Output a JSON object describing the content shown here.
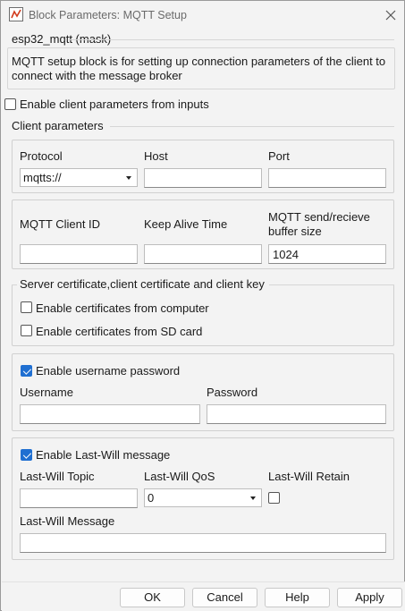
{
  "window": {
    "title": "Block Parameters: MQTT Setup",
    "accent": "#1f6fd1"
  },
  "mask": {
    "heading": "esp32_mqtt (mask)",
    "description_line1": "MQTT setup block is for setting up connection parameters of the client to",
    "description_line2": "connect with the message broker"
  },
  "enable_inputs": {
    "label": "Enable client parameters from inputs",
    "checked": false
  },
  "client_params": {
    "title": "Client parameters",
    "protocol_label": "Protocol",
    "protocol_value": "mqtts://",
    "host_label": "Host",
    "host_value": "",
    "port_label": "Port",
    "port_value": "",
    "client_id_label": "MQTT Client ID",
    "client_id_value": "",
    "keep_alive_label": "Keep Alive Time",
    "keep_alive_value": "",
    "buffer_label_line1": "MQTT send/recieve",
    "buffer_label_line2": "buffer size",
    "buffer_value": "1024"
  },
  "certificates": {
    "title": "Server certificate,client certificate and client key",
    "from_computer_label": "Enable certificates from computer",
    "from_computer_checked": false,
    "from_sd_label": "Enable certificates from SD card",
    "from_sd_checked": false
  },
  "auth": {
    "enable_label": "Enable username password",
    "enable_checked": true,
    "username_label": "Username",
    "username_value": "",
    "password_label": "Password",
    "password_value": ""
  },
  "last_will": {
    "enable_label": "Enable Last-Will message",
    "enable_checked": true,
    "topic_label": "Last-Will Topic",
    "topic_value": "",
    "qos_label": "Last-Will QoS",
    "qos_value": "0",
    "retain_label": "Last-Will Retain",
    "retain_checked": false,
    "message_label": "Last-Will Message",
    "message_value": ""
  },
  "buttons": {
    "ok": "OK",
    "cancel": "Cancel",
    "help": "Help",
    "apply": "Apply"
  },
  "icons": {
    "app": "simulink-block-icon",
    "close": "close-icon",
    "dropdown": "chevron-down-icon",
    "check": "checkmark-icon"
  }
}
